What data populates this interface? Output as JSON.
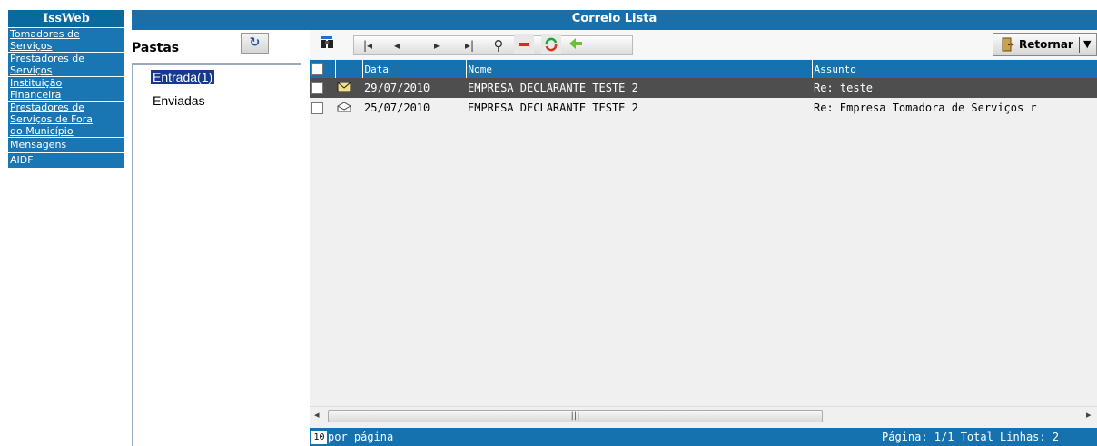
{
  "nav": {
    "title": "IssWeb",
    "items": [
      {
        "label": "Tomadores de Serviços",
        "l1": "Tomadores de",
        "l2": "Serviços"
      },
      {
        "label": "Prestadores de Serviços",
        "l1": "Prestadores de",
        "l2": "Serviços"
      },
      {
        "label": "Instituição Financeira",
        "l1": "Instituição",
        "l2": "Financeira"
      },
      {
        "label": "Prestadores de Serviços de Fora do Município",
        "l1": "Prestadores de",
        "l2": "Serviços de Fora",
        "l3": "do Município"
      },
      {
        "label": "Mensagens"
      },
      {
        "label": "AIDF"
      }
    ]
  },
  "header": {
    "title": "Correio Lista"
  },
  "pastas": {
    "title": "Pastas",
    "refresh_icon": "refresh-icon",
    "folders": [
      "Entrada(1)",
      "Enviadas"
    ]
  },
  "toolbar": {
    "retornar_label": "Retornar",
    "icons": [
      "search-binoculars-icon",
      "first-page-icon",
      "prev-page-icon",
      "next-page-icon",
      "last-page-icon",
      "find-icon",
      "remove-icon",
      "reload-icon",
      "move-icon"
    ]
  },
  "table": {
    "columns": [
      "Data",
      "Nome",
      "Assunto"
    ],
    "rows": [
      {
        "date": "29/07/2010",
        "nome": "EMPRESA DECLARANTE TESTE 2",
        "assunto": "Re: teste",
        "status": "unread"
      },
      {
        "date": "25/07/2010",
        "nome": "EMPRESA DECLARANTE TESTE 2",
        "assunto": "Re: Empresa Tomadora de Serviços r",
        "status": "read"
      }
    ]
  },
  "footer": {
    "per_page_value": "10",
    "per_page_label": "por página",
    "paging_text": "Página: 1/1 Total Linhas: 2"
  },
  "colors": {
    "nav_blue": "#1976b3",
    "header_blue": "#1b6fa8",
    "grid_header": "#1672ae",
    "selected_row": "#4e4e4e"
  }
}
